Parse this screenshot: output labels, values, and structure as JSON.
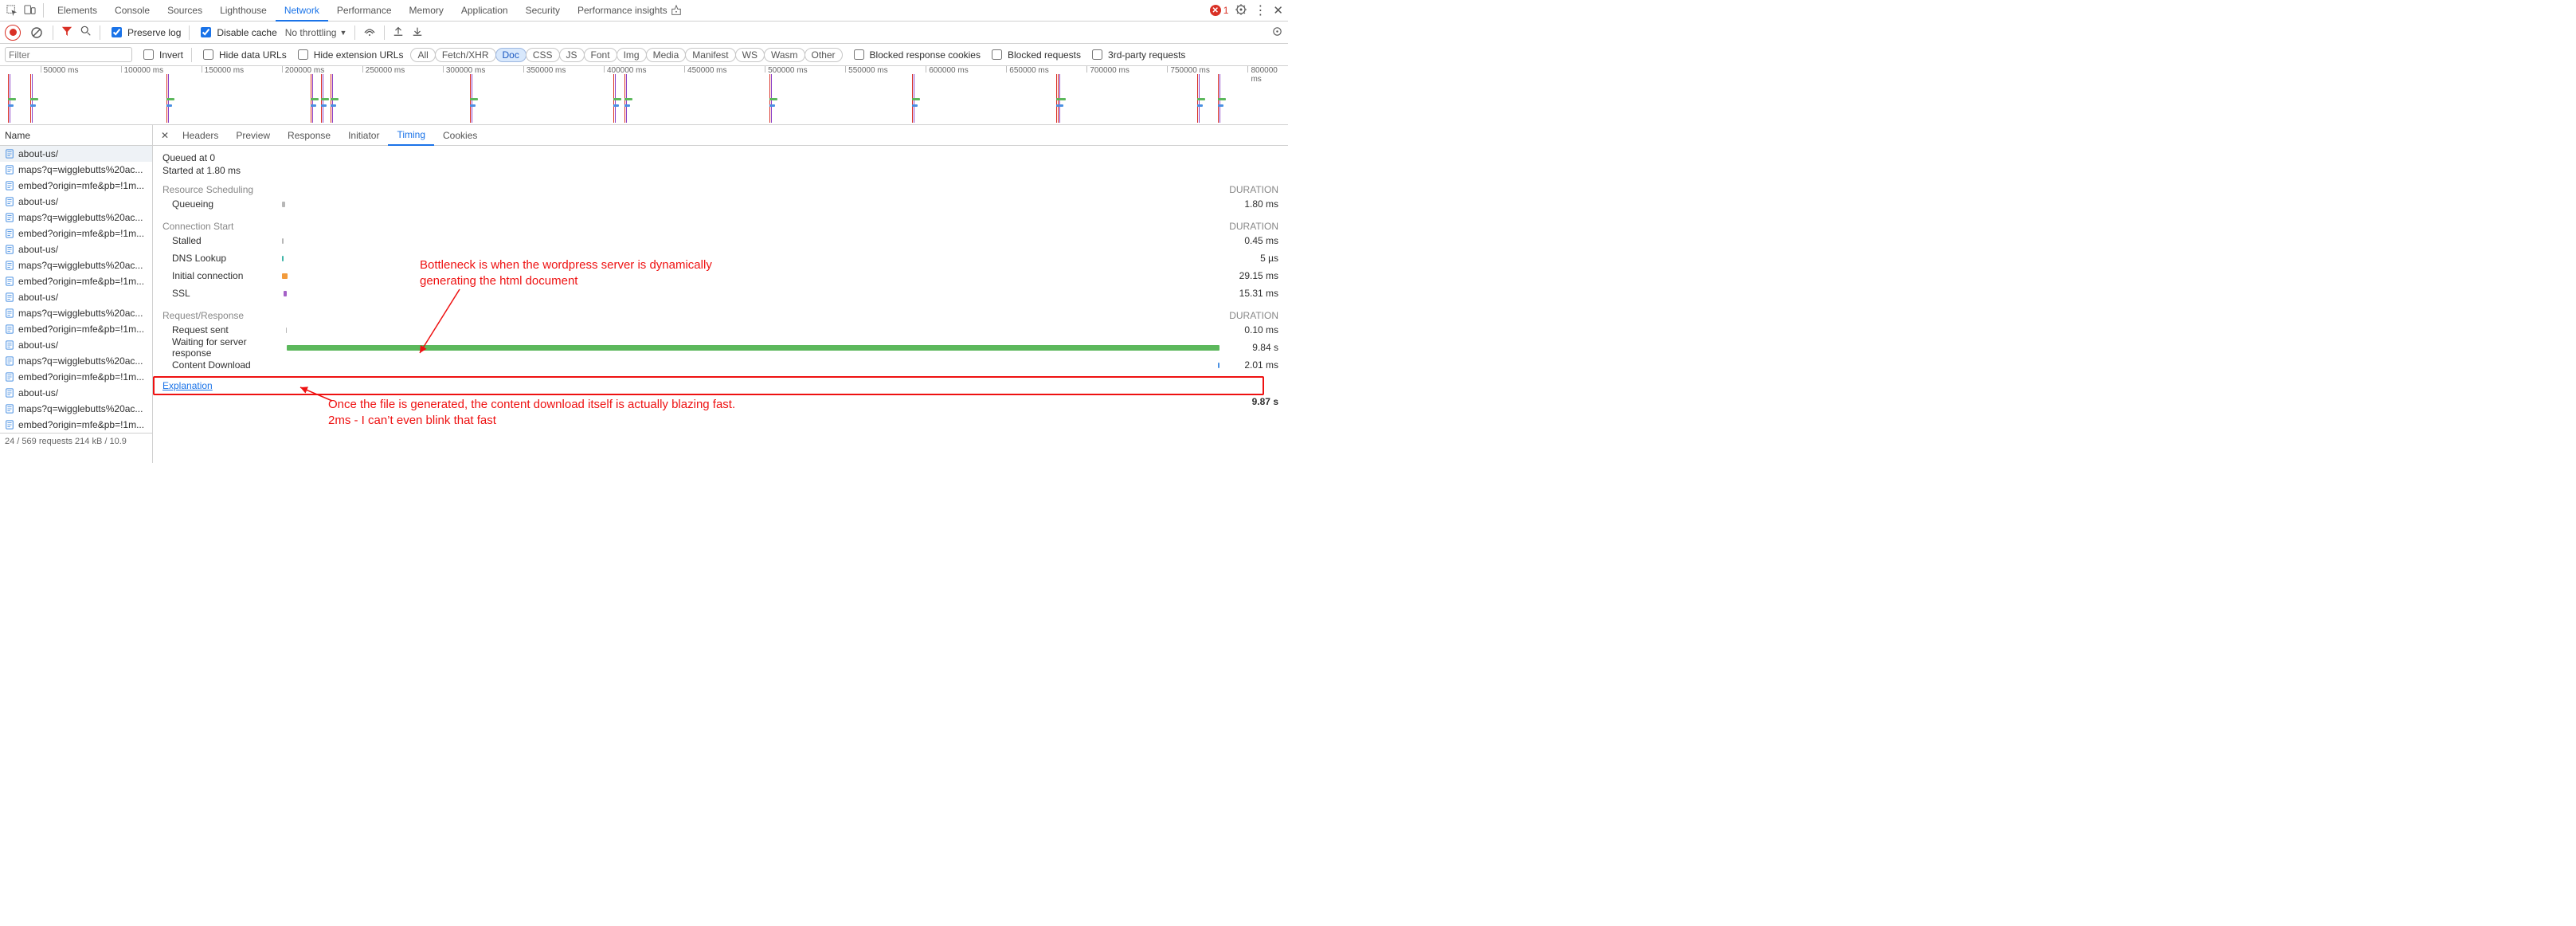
{
  "top_tabs": {
    "items": [
      "Elements",
      "Console",
      "Sources",
      "Lighthouse",
      "Network",
      "Performance",
      "Memory",
      "Application",
      "Security",
      "Performance insights"
    ],
    "active": "Network",
    "error_count": "1"
  },
  "toolbar": {
    "preserve_log": "Preserve log",
    "disable_cache": "Disable cache",
    "throttling": "No throttling"
  },
  "filter_row": {
    "placeholder": "Filter",
    "invert": "Invert",
    "hide_data_urls": "Hide data URLs",
    "hide_ext_urls": "Hide extension URLs",
    "types": [
      "All",
      "Fetch/XHR",
      "Doc",
      "CSS",
      "JS",
      "Font",
      "Img",
      "Media",
      "Manifest",
      "WS",
      "Wasm",
      "Other"
    ],
    "type_active": "Doc",
    "blocked_cookies": "Blocked response cookies",
    "blocked_requests": "Blocked requests",
    "third_party": "3rd-party requests"
  },
  "timeline": {
    "ticks": [
      "50000 ms",
      "100000 ms",
      "150000 ms",
      "200000 ms",
      "250000 ms",
      "300000 ms",
      "350000 ms",
      "400000 ms",
      "450000 ms",
      "500000 ms",
      "550000 ms",
      "600000 ms",
      "650000 ms",
      "700000 ms",
      "750000 ms",
      "800000 ms"
    ]
  },
  "reqlist": {
    "header": "Name",
    "rows": [
      {
        "name": "about-us/",
        "sel": true
      },
      {
        "name": "maps?q=wigglebutts%20ac..."
      },
      {
        "name": "embed?origin=mfe&pb=!1m..."
      },
      {
        "name": "about-us/"
      },
      {
        "name": "maps?q=wigglebutts%20ac..."
      },
      {
        "name": "embed?origin=mfe&pb=!1m..."
      },
      {
        "name": "about-us/"
      },
      {
        "name": "maps?q=wigglebutts%20ac..."
      },
      {
        "name": "embed?origin=mfe&pb=!1m..."
      },
      {
        "name": "about-us/"
      },
      {
        "name": "maps?q=wigglebutts%20ac..."
      },
      {
        "name": "embed?origin=mfe&pb=!1m..."
      },
      {
        "name": "about-us/"
      },
      {
        "name": "maps?q=wigglebutts%20ac..."
      },
      {
        "name": "embed?origin=mfe&pb=!1m..."
      },
      {
        "name": "about-us/"
      },
      {
        "name": "maps?q=wigglebutts%20ac..."
      },
      {
        "name": "embed?origin=mfe&pb=!1m..."
      }
    ],
    "status": "24 / 569 requests   214 kB / 10.9"
  },
  "details": {
    "tabs": [
      "Headers",
      "Preview",
      "Response",
      "Initiator",
      "Timing",
      "Cookies"
    ],
    "active": "Timing",
    "queued": "Queued at 0",
    "started": "Started at 1.80 ms",
    "sections": {
      "resource_scheduling": {
        "title": "Resource Scheduling",
        "dur_label": "DURATION",
        "rows": [
          {
            "lab": "Queueing",
            "val": "1.80 ms",
            "cls": "gray",
            "left": 0,
            "w": 0.3
          }
        ]
      },
      "connection_start": {
        "title": "Connection Start",
        "dur_label": "DURATION",
        "rows": [
          {
            "lab": "Stalled",
            "val": "0.45 ms",
            "cls": "gray",
            "left": 0,
            "w": 0.2
          },
          {
            "lab": "DNS Lookup",
            "val": "5 µs",
            "cls": "teal",
            "left": 0,
            "w": 0.15
          },
          {
            "lab": "Initial connection",
            "val": "29.15 ms",
            "cls": "orange",
            "left": 0,
            "w": 0.6
          },
          {
            "lab": "SSL",
            "val": "15.31 ms",
            "cls": "purple",
            "left": 0.2,
            "w": 0.3
          }
        ]
      },
      "request_response": {
        "title": "Request/Response",
        "dur_label": "DURATION",
        "rows": [
          {
            "lab": "Request sent",
            "val": "0.10 ms",
            "cls": "gray",
            "left": 0.4,
            "w": 0.15
          },
          {
            "lab": "Waiting for server response",
            "val": "9.84 s",
            "cls": "green",
            "left": 0.5,
            "w": 100
          },
          {
            "lab": "Content Download",
            "val": "2.01 ms",
            "cls": "blue",
            "left": 100.3,
            "w": 0.25
          }
        ]
      }
    },
    "total": "9.87 s",
    "explanation": "Explanation"
  },
  "annotations": {
    "top": "Bottleneck is when the wordpress server is dynamically generating the html document",
    "bottom": "Once the file is generated, the content download itself is actually blazing fast. 2ms - I can’t even blink that fast"
  }
}
